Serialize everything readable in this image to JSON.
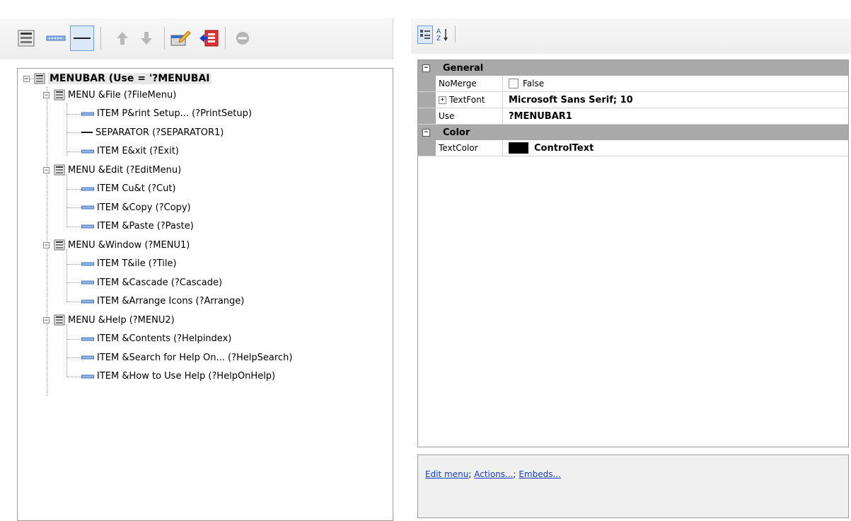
{
  "toolbar": {
    "buttons": [
      {
        "icon": "menu-icon"
      },
      {
        "icon": "item-icon"
      },
      {
        "icon": "separator-icon",
        "pressed": true
      },
      {
        "icon": "move-up-icon"
      },
      {
        "icon": "move-down-icon"
      },
      {
        "icon": "edit-icon"
      },
      {
        "icon": "exit-icon"
      },
      {
        "icon": "delete-icon"
      }
    ]
  },
  "tree": {
    "root": {
      "label": "MENUBAR (Use = '?MENUBAI"
    },
    "nodes": [
      {
        "label": "MENU  &File (?FileMenu)",
        "type": "menu"
      },
      {
        "label": "ITEM  P&rint Setup...  (?PrintSetup)",
        "type": "item"
      },
      {
        "label": "SEPARATOR    (?SEPARATOR1)",
        "type": "separator"
      },
      {
        "label": "ITEM  E&xit  (?Exit)",
        "type": "item"
      },
      {
        "label": "MENU  &Edit (?EditMenu)",
        "type": "menu"
      },
      {
        "label": "ITEM  Cu&t  (?Cut)",
        "type": "item"
      },
      {
        "label": "ITEM  &Copy  (?Copy)",
        "type": "item"
      },
      {
        "label": "ITEM  &Paste  (?Paste)",
        "type": "item"
      },
      {
        "label": "MENU  &Window (?MENU1)",
        "type": "menu"
      },
      {
        "label": "ITEM  T&ile  (?Tile)",
        "type": "item"
      },
      {
        "label": "ITEM  &Cascade  (?Cascade)",
        "type": "item"
      },
      {
        "label": "ITEM  &Arrange Icons  (?Arrange)",
        "type": "item"
      },
      {
        "label": "MENU  &Help (?MENU2)",
        "type": "menu"
      },
      {
        "label": "ITEM  &Contents  (?Helpindex)",
        "type": "item"
      },
      {
        "label": "ITEM  &Search for Help On...  (?HelpSearch)",
        "type": "item"
      },
      {
        "label": "ITEM  &How to Use Help  (?HelpOnHelp)",
        "type": "item"
      }
    ]
  },
  "property_toolbar": {
    "buttons": [
      {
        "icon": "categorized-icon",
        "pressed": true
      },
      {
        "icon": "sort-alpha-icon"
      }
    ]
  },
  "properties": {
    "categories": [
      {
        "name": "General",
        "rows": [
          {
            "name": "NoMerge",
            "value": "False"
          },
          {
            "name": "TextFont",
            "value": "Microsoft Sans Serif; 10"
          },
          {
            "name": "Use",
            "value": "?MENUBAR1"
          }
        ]
      },
      {
        "name": "Color",
        "rows": [
          {
            "name": "TextColor",
            "value": "ControlText",
            "swatch": "#000000"
          }
        ]
      }
    ]
  },
  "commands": {
    "edit_menu": "Edit menu",
    "actions": "Actions...",
    "embeds": "Embeds..."
  }
}
